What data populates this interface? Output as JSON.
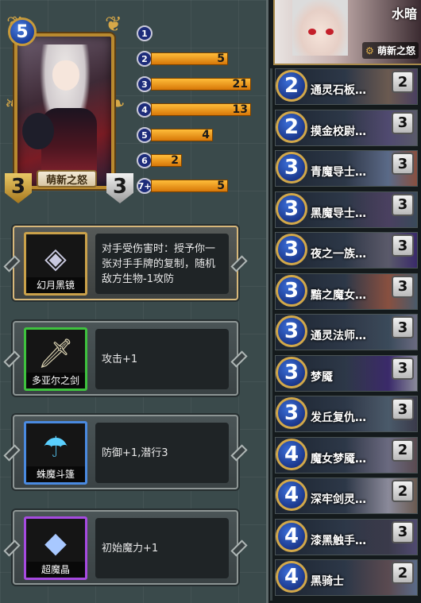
{
  "hero": {
    "name": "萌新之怒",
    "mana": "5",
    "attack": "3",
    "health": "3"
  },
  "mana_curve": [
    {
      "cost": "1",
      "count": "",
      "fill": 0.0
    },
    {
      "cost": "2",
      "count": "5",
      "fill": 0.77
    },
    {
      "cost": "3",
      "count": "21",
      "fill": 1.0
    },
    {
      "cost": "4",
      "count": "13",
      "fill": 1.0
    },
    {
      "cost": "5",
      "count": "4",
      "fill": 0.62
    },
    {
      "cost": "6",
      "count": "2",
      "fill": 0.31
    },
    {
      "cost": "7+",
      "count": "5",
      "fill": 0.77
    }
  ],
  "equipment": [
    {
      "name": "幻月黑镜",
      "desc": "对手受伤害时：授予你一张对手手牌的复制，随机敌方生物-1攻防",
      "rarity": "gold",
      "icon": "mirror-icon"
    },
    {
      "name": "多亚尔之剑",
      "desc": "攻击+1",
      "rarity": "green",
      "icon": "sword-icon"
    },
    {
      "name": "蛛魔斗篷",
      "desc": "防御+1,潜行3",
      "rarity": "blue",
      "icon": "cloak-icon"
    },
    {
      "name": "超魔晶",
      "desc": "初始魔力+1",
      "rarity": "purple",
      "icon": "crystal-icon"
    }
  ],
  "deck_panel": {
    "title": "水暗",
    "hero_name": "萌新之怒",
    "cards": [
      {
        "cost": "2",
        "name": "通灵石板…",
        "count": "2"
      },
      {
        "cost": "2",
        "name": "摸金校尉…",
        "count": "3"
      },
      {
        "cost": "3",
        "name": "青魔导士…",
        "count": "3"
      },
      {
        "cost": "3",
        "name": "黑魔导士…",
        "count": "3"
      },
      {
        "cost": "3",
        "name": "夜之一族…",
        "count": "3"
      },
      {
        "cost": "3",
        "name": "黯之魔女…",
        "count": "3"
      },
      {
        "cost": "3",
        "name": "通灵法师…",
        "count": "3"
      },
      {
        "cost": "3",
        "name": "梦魇",
        "count": "3"
      },
      {
        "cost": "3",
        "name": "发丘复仇…",
        "count": "3"
      },
      {
        "cost": "4",
        "name": "魔女梦魇…",
        "count": "2"
      },
      {
        "cost": "4",
        "name": "深牢剑灵…",
        "count": "2"
      },
      {
        "cost": "4",
        "name": "漆黑触手…",
        "count": "3"
      },
      {
        "cost": "4",
        "name": "黑骑士",
        "count": "2"
      }
    ]
  }
}
